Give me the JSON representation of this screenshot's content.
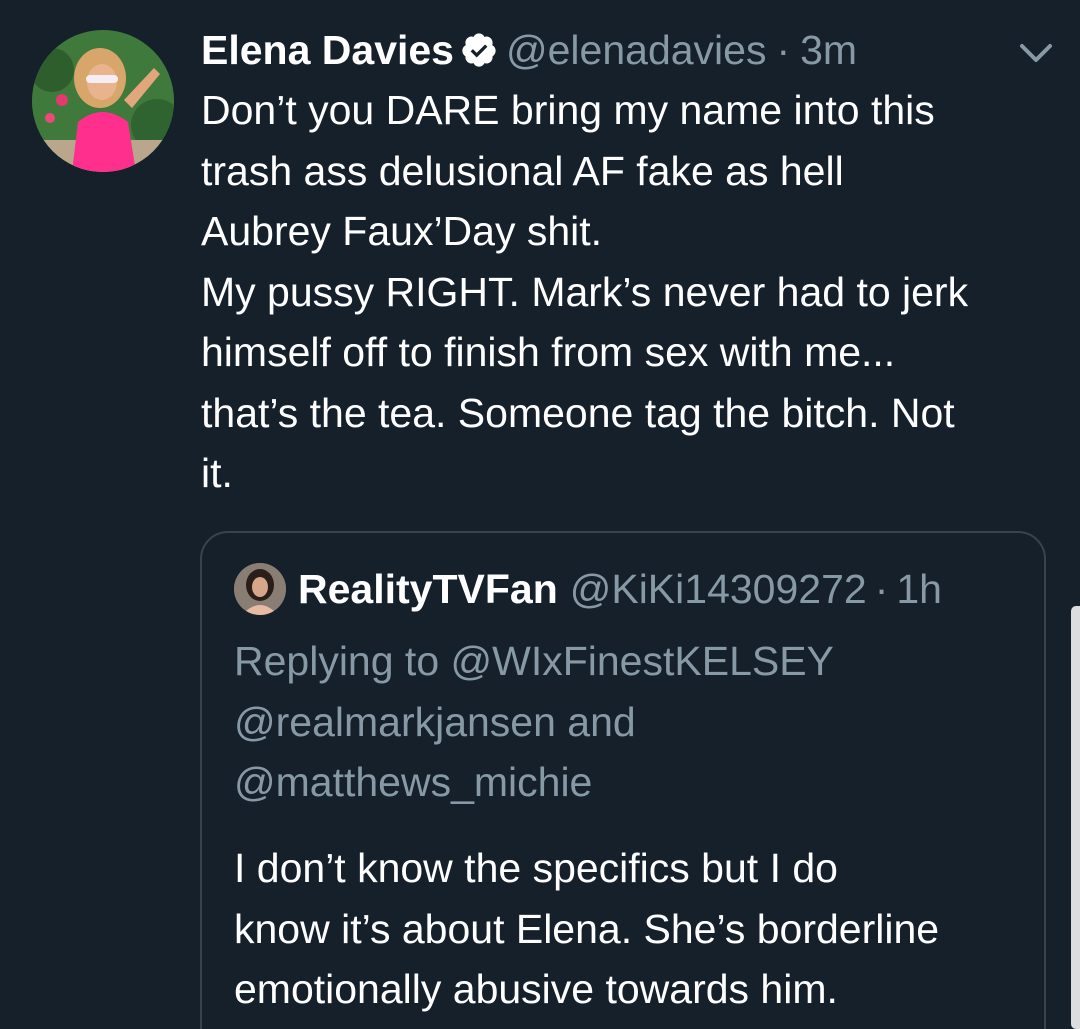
{
  "colors": {
    "background": "#15202b",
    "text_primary": "#ffffff",
    "text_secondary": "#8899a6",
    "border": "#38444d",
    "verified_badge": "#ffffff"
  },
  "tweet": {
    "author_name": "Elena Davies",
    "verified_icon": "verified-badge-icon",
    "handle": "@elenadavies",
    "separator": "·",
    "time": "3m",
    "menu_icon": "chevron-down-icon",
    "text": "Don’t you DARE bring my name into this\ntrash ass delusional AF fake as hell\nAubrey Faux’Day shit.\nMy pussy RIGHT. Mark’s never had to jerk\nhimself off to finish from sex with me...\nthat’s the tea. Someone tag the bitch. Not\nit."
  },
  "quoted_tweet": {
    "author_name": "RealityTVFan",
    "handle": "@KiKi14309272",
    "separator": "·",
    "time": "1h",
    "replying_line1": "Replying to @WIxFinestKELSEY",
    "replying_line2": "@realmarkjansen and",
    "replying_line3": "@matthews_michie",
    "text": "I don’t know the specifics but I do\nknow it’s about Elena. She’s borderline\nemotionally abusive towards him."
  }
}
